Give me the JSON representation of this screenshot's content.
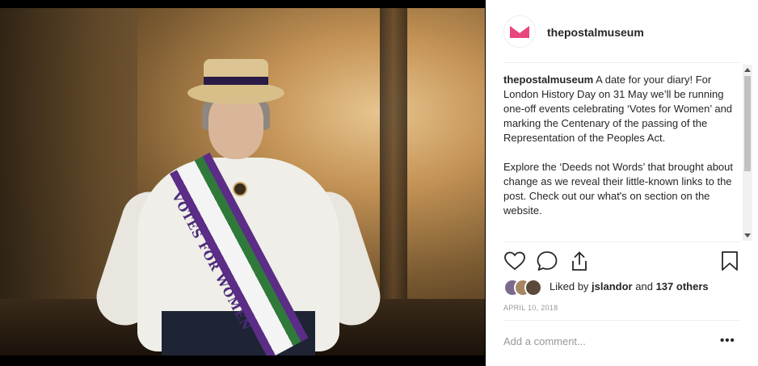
{
  "post": {
    "username": "thepostalmuseum",
    "caption_user": "thepostalmuseum",
    "caption_p1": "A date for your diary! For London History Day on 31 May we’ll be running one-off events celebrating ‘Votes for Women’ and marking the Centenary of the passing of the Representation of the Peoples Act.",
    "caption_p2": "Explore the ‘Deeds not Words’ that brought about change as we reveal their little-known links to the post. Check out our what's on section on the website.",
    "liked_by_prefix": "Liked by",
    "liked_by_user": "jslandor",
    "liked_by_and": "and",
    "liked_by_others": "137 others",
    "date": "APRIL 10, 2018",
    "comment_placeholder": "Add a comment...",
    "more_options": "•••"
  },
  "photo": {
    "sash_text": "VOTES FOR WOMEN"
  },
  "icons": {
    "avatar": "envelope-logo-icon",
    "like": "heart-icon",
    "comment": "comment-icon",
    "share": "share-icon",
    "save": "bookmark-icon"
  },
  "colors": {
    "brand_pink": "#e8467c",
    "text": "#262626",
    "muted": "#999999",
    "divider": "#efefef"
  }
}
